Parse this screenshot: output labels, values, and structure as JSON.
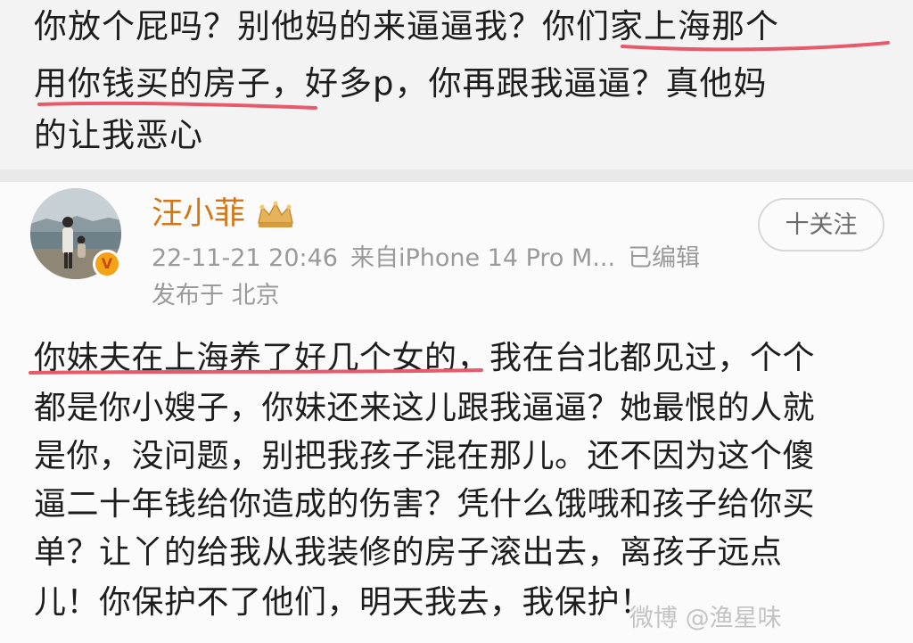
{
  "top_text": {
    "line1": "你放个屁吗？别他妈的来逼逼我？你们家上海那个",
    "line2": "用你钱买的房子，好多p，你再跟我逼逼？真他妈",
    "line3": "的让我恶心"
  },
  "post": {
    "username": "汪小菲",
    "timestamp": "22-11-21 20:46",
    "source": "来自iPhone 14 Pro M...",
    "edited": "已编辑",
    "location": "发布于 北京",
    "follow_label": "十关注",
    "lines": [
      "你妹夫在上海养了好几个女的，我在台北都见过，个个",
      "都是你小嫂子，你妹还来这儿跟我逼逼？她最恨的人就",
      "是你，没问题，别把我孩子混在那儿。还不因为这个傻",
      "逼二十年钱给你造成的伤害？凭什么饿哦和孩子给你买",
      "单？让丫的给我从我装修的房子滚出去，离孩子远点",
      "儿！你保护不了他们，明天我去，我保护！"
    ]
  },
  "watermark": "微博 @渔星味",
  "colors": {
    "username": "#d47616",
    "underline": "#e85a6a",
    "meta": "#9a9a9a",
    "verify_badge": "#f3a316"
  },
  "icons": {
    "verified": "verified-badge-icon",
    "membership": "crown-icon",
    "follow": "plus-icon"
  }
}
